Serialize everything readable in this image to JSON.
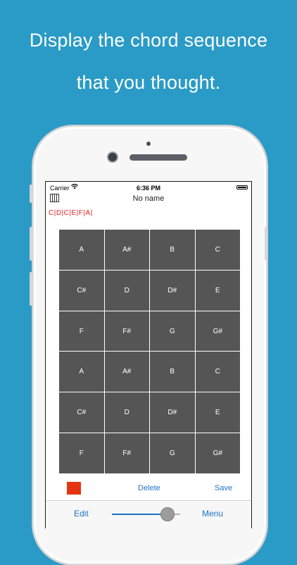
{
  "headline": {
    "line1": "Display the chord sequence",
    "line2": "that you thought."
  },
  "status_bar": {
    "carrier": "Carrier",
    "time": "6:36 PM"
  },
  "nav": {
    "title": "No name",
    "left_icon": "piano-icon"
  },
  "sequence_text": "C|D|C|E|F|A|",
  "chord_grid": {
    "rows": [
      [
        "A",
        "A#",
        "B",
        "C"
      ],
      [
        "C#",
        "D",
        "D#",
        "E"
      ],
      [
        "F",
        "F#",
        "G",
        "G#"
      ],
      [
        "A",
        "A#",
        "B",
        "C"
      ],
      [
        "C#",
        "D",
        "D#",
        "E"
      ],
      [
        "F",
        "F#",
        "G",
        "G#"
      ]
    ]
  },
  "toolbar": {
    "delete_label": "Delete",
    "save_label": "Save",
    "record_color": "#e63312"
  },
  "bottom_bar": {
    "edit_label": "Edit",
    "menu_label": "Menu",
    "slider_value": 0.72
  },
  "colors": {
    "background": "#2a9bc6",
    "cell": "#555555",
    "accent": "#1a73c9",
    "sequence": "#e02020"
  }
}
